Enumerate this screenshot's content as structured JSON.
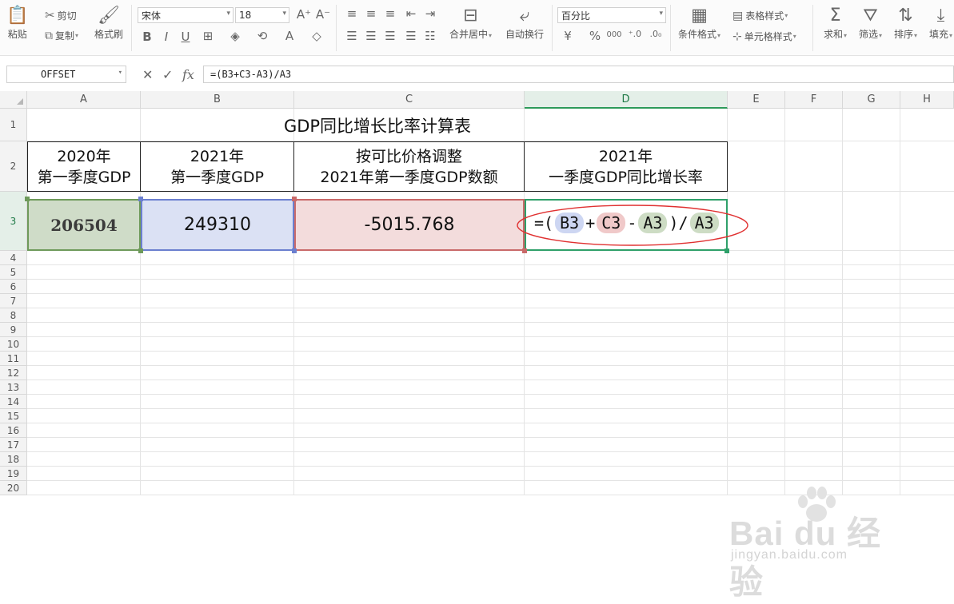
{
  "ribbon": {
    "paste": "粘贴",
    "cut": "剪切",
    "copy": "复制",
    "format_painter": "格式刷",
    "font_name": "宋体",
    "font_size": "18",
    "number_format": "百分比",
    "merge_center": "合并居中",
    "auto_wrap": "自动换行",
    "conditional_format": "条件格式",
    "table_style": "表格样式",
    "cell_style": "单元格样式",
    "sum": "求和",
    "filter": "筛选",
    "sort": "排序",
    "fill": "填充",
    "currency_symbol": "¥",
    "percent_symbol": "%",
    "thousands_symbol": "000"
  },
  "formula_bar": {
    "name_box": "OFFSET",
    "fx_label": "fx",
    "formula": "=(B3+C3-A3)/A3"
  },
  "columns": [
    "A",
    "B",
    "C",
    "D",
    "E",
    "F",
    "G",
    "H"
  ],
  "rows": [
    "1",
    "2",
    "3",
    "4",
    "5",
    "6",
    "7",
    "8",
    "9",
    "10",
    "11",
    "12",
    "13",
    "14",
    "15",
    "16",
    "17",
    "18",
    "19",
    "20"
  ],
  "sheet": {
    "title": "GDP同比增长比率计算表",
    "headers": [
      [
        "2020年",
        "第一季度GDP"
      ],
      [
        "2021年",
        "第一季度GDP"
      ],
      [
        "按可比价格调整",
        "2021年第一季度GDP数额"
      ],
      [
        "2021年",
        "一季度GDP同比增长率"
      ]
    ],
    "a3": "206504",
    "b3": "249310",
    "c3": "-5015.768",
    "d3_formula": {
      "eq": "=",
      "open": "(",
      "ref1": "B3",
      "op1": "+",
      "ref2": "C3",
      "op2": "-",
      "ref3": "A3",
      "close": ")",
      "div": "/",
      "ref4": "A3"
    }
  },
  "watermark": {
    "brand": "Bai du 经验",
    "url": "jingyan.baidu.com"
  },
  "colors": {
    "accent_green": "#2d9a5a",
    "a3_fill": "#cfdcc8",
    "b3_fill": "#dbe1f4",
    "c3_fill": "#f3dcdc",
    "ellipse": "#e03030"
  }
}
